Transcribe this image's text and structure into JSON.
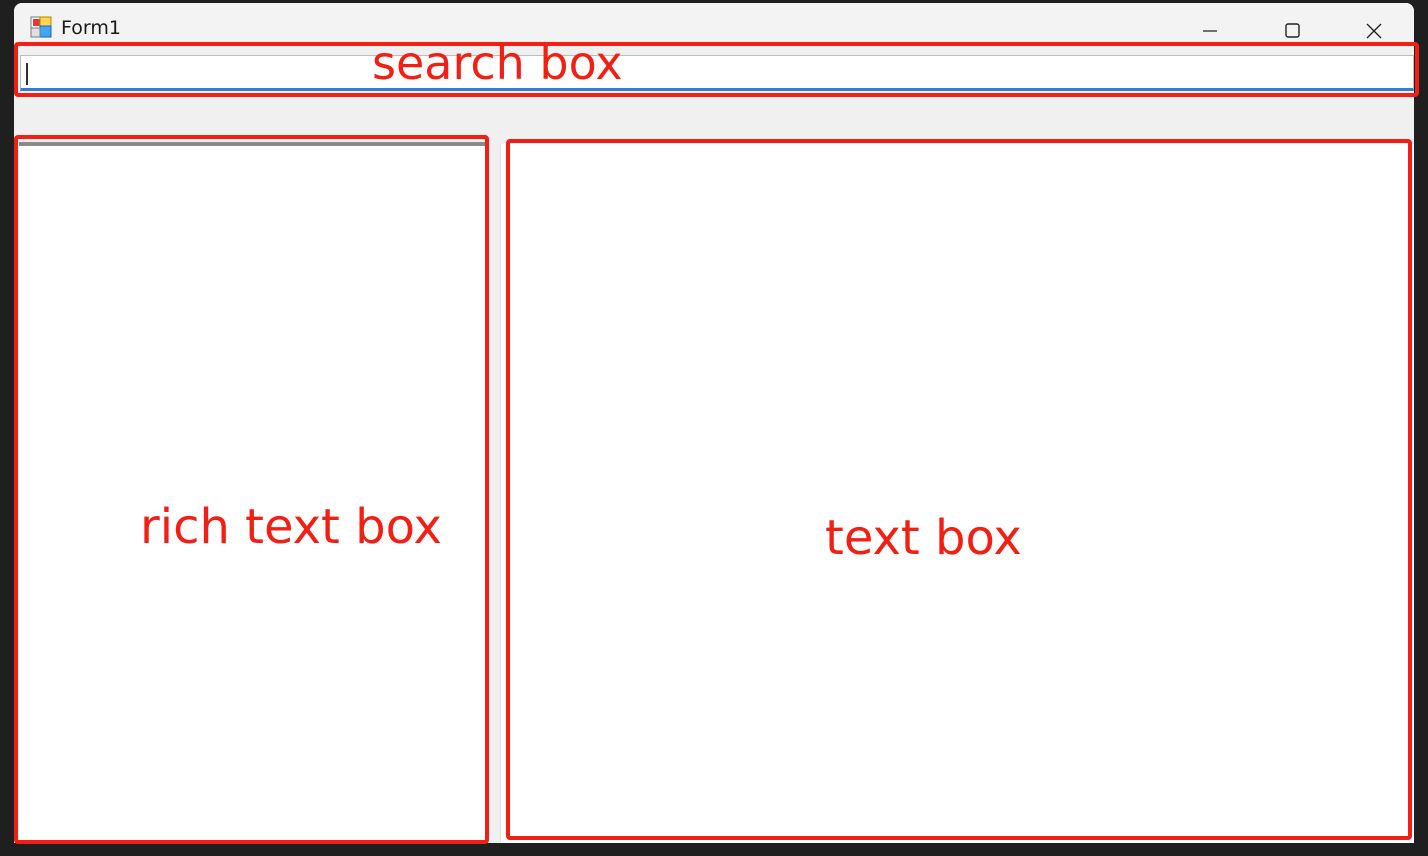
{
  "window": {
    "title": "Form1",
    "controls": {
      "minimize_icon": "minimize-icon",
      "maximize_icon": "maximize-icon",
      "close_icon": "close-icon"
    }
  },
  "search": {
    "value": "",
    "placeholder": ""
  },
  "rich_text_box": {
    "value": ""
  },
  "text_box": {
    "value": ""
  },
  "annotations": {
    "search_label": "search box",
    "rich_text_label": "rich text box",
    "text_box_label": "text box",
    "color": "#f21f14"
  }
}
